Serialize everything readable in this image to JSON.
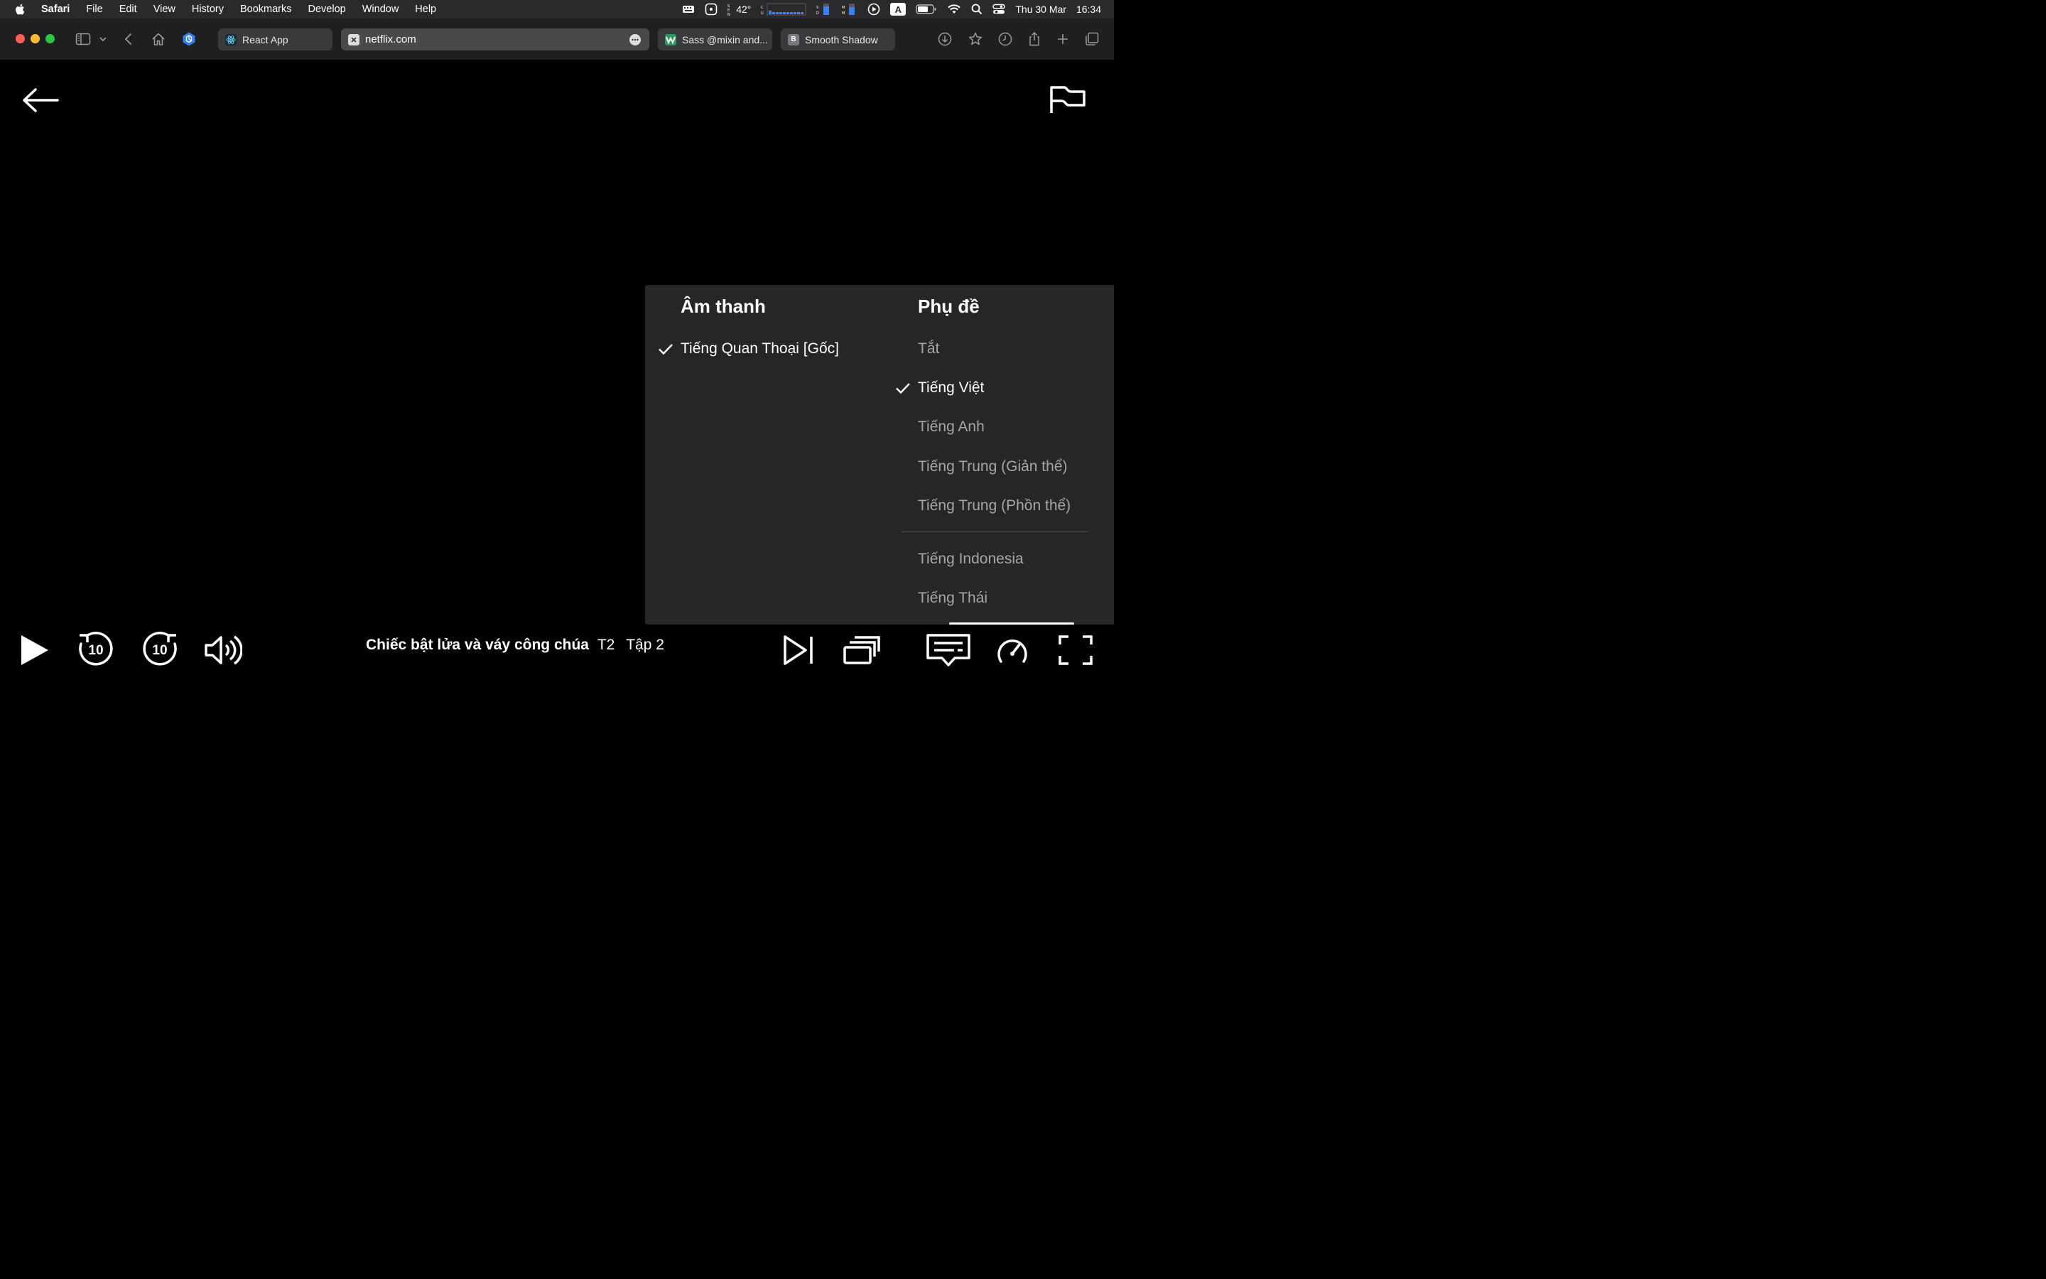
{
  "menubar": {
    "items": [
      "Safari",
      "File",
      "Edit",
      "View",
      "History",
      "Bookmarks",
      "Develop",
      "Window",
      "Help"
    ],
    "temperature": "42°",
    "keyboard_input": "A",
    "date": "Thu 30 Mar",
    "time": "16:34"
  },
  "browser": {
    "tabs": [
      {
        "label": "React App",
        "icon": "react-icon"
      },
      {
        "label": "netflix.com",
        "icon": "close-icon",
        "active": true
      },
      {
        "label": "Sass @mixin and...",
        "icon": "w-favicon"
      },
      {
        "label": "Smooth Shadow",
        "icon": "b-favicon",
        "favicon_letter": "B"
      }
    ]
  },
  "player": {
    "audio": {
      "heading": "Âm thanh",
      "options": [
        {
          "label": "Tiếng Quan Thoại [Gốc]",
          "selected": true
        }
      ]
    },
    "subtitles": {
      "heading": "Phụ đề",
      "options": [
        {
          "label": "Tắt",
          "selected": false
        },
        {
          "label": "Tiếng Việt",
          "selected": true
        },
        {
          "label": "Tiếng Anh",
          "selected": false
        },
        {
          "label": "Tiếng Trung (Giản thể)",
          "selected": false
        },
        {
          "label": "Tiếng Trung (Phồn thể)",
          "selected": false
        },
        {
          "label": "Tiếng Indonesia",
          "selected": false
        },
        {
          "label": "Tiếng Thái",
          "selected": false
        }
      ]
    },
    "title": {
      "show": "Chiếc bật lửa và váy công chúa",
      "season": "T2",
      "episode": "Tập 2"
    },
    "skip_seconds": "10"
  },
  "colors": {
    "panel_bg": "#262626",
    "unselected_text": "#a6a6a6",
    "selected_text": "#ffffff"
  }
}
